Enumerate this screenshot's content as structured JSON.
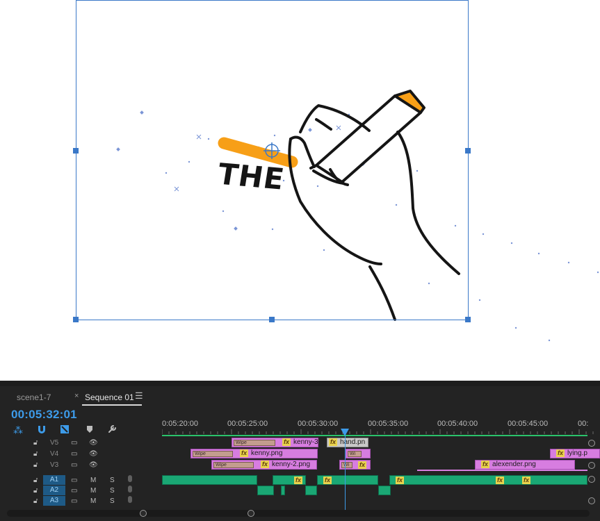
{
  "colors": {
    "accent": "#3d9be9",
    "video_clip": "#d77de0",
    "audio_clip": "#1aa774",
    "fx_badge": "#e8d24e",
    "marker_orange": "#f79f17"
  },
  "program": {
    "artwork_text": "THE",
    "icons": [
      "anchor-point-icon",
      "bounding-box-handle-icon"
    ]
  },
  "timeline": {
    "tabs": [
      {
        "label": "scene1-7"
      },
      {
        "label": "Sequence 01"
      }
    ],
    "close_label": "×",
    "menu_label": "☰",
    "timecode": "00:05:32:01",
    "tools": [
      "snap-icon",
      "linked-selection-icon",
      "add-marker-icon",
      "marker-icon",
      "wrench-icon"
    ],
    "ruler": [
      "0:05:20:00",
      "00:05:25:00",
      "00:05:30:00",
      "00:05:35:00",
      "00:05:40:00",
      "00:05:45:00",
      "00:"
    ],
    "tracks": {
      "video": [
        {
          "label": "V5"
        },
        {
          "label": "V4"
        },
        {
          "label": "V3"
        }
      ],
      "audio": [
        {
          "label": "A1",
          "mute": "M",
          "solo": "S"
        },
        {
          "label": "A2",
          "mute": "M",
          "solo": "S"
        },
        {
          "label": "A3",
          "mute": "M",
          "solo": "S"
        }
      ]
    },
    "clips": {
      "v5_a_transition": "Wipe",
      "v5_a": "kenny-3.",
      "v5_b": "hand.pn",
      "v4_a_transition": "Wipe",
      "v4_a": "kenny.png",
      "v4_b_transition": "Wi",
      "v4_c": "lying.p",
      "v3_a_transition": "Wipe",
      "v3_a": "kenny-2.png",
      "v3_b_transition": "Wi",
      "v3_c": "alexender.png"
    },
    "fx_label": "fx"
  }
}
